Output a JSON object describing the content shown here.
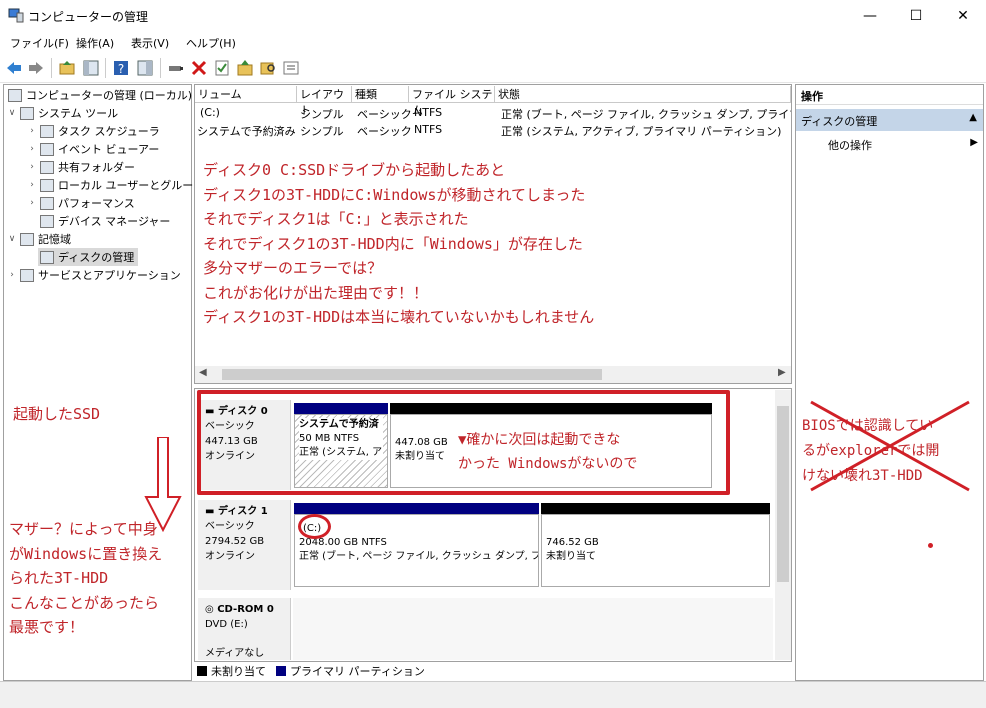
{
  "window": {
    "title": "コンピューターの管理",
    "minimize": "—",
    "maximize": "☐",
    "close": "✕"
  },
  "menu": [
    "ファイル(F)",
    "操作(A)",
    "表示(V)",
    "ヘルプ(H)"
  ],
  "tree": [
    {
      "label": "コンピューターの管理 (ローカル)",
      "icon": "computer-management-icon"
    },
    {
      "label": "システム ツール",
      "icon": "tools-icon"
    },
    {
      "label": "タスク スケジューラ",
      "icon": "clock-icon"
    },
    {
      "label": "イベント ビューアー",
      "icon": "event-viewer-icon"
    },
    {
      "label": "共有フォルダー",
      "icon": "shared-folder-icon"
    },
    {
      "label": "ローカル ユーザーとグループ",
      "icon": "users-icon"
    },
    {
      "label": "パフォーマンス",
      "icon": "performance-icon"
    },
    {
      "label": "デバイス マネージャー",
      "icon": "device-manager-icon"
    },
    {
      "label": "記憶域",
      "icon": "storage-icon"
    },
    {
      "label": "ディスクの管理",
      "icon": "disk-management-icon"
    },
    {
      "label": "サービスとアプリケーション",
      "icon": "services-icon"
    }
  ],
  "volume_table": {
    "columns": [
      "リューム",
      "レイアウト",
      "種類",
      "ファイル システム",
      "状態"
    ],
    "rows": [
      [
        "(C:)",
        "シンプル",
        "ベーシック",
        "NTFS",
        "正常 (ブート, ページ ファイル, クラッシュ ダンプ, プライマリ パーティ"
      ],
      [
        "システムで予約済み",
        "シンプル",
        "ベーシック",
        "NTFS",
        "正常 (システム, アクティブ, プライマリ パーティション)"
      ]
    ]
  },
  "annotations": {
    "main_lines": [
      "ディスク0 C:SSDドライブから起動したあと",
      "ディスク1の3T-HDDにC:Windowsが移動されてしまった",
      "それでディスク1は「C:」と表示された",
      "それでディスク1の3T-HDD内に「Windows」が存在した",
      "多分マザーのエラーでは？",
      "これがお化けが出た理由です！！",
      "ディスク1の3T-HDDは本当に壊れていないかもしれません"
    ],
    "ssd_label": "起動したSSD",
    "unalloc_note": [
      "▼確かに次回は起動できな",
      "かった Windowsがないので"
    ],
    "left_note": [
      "マザー？によって中身",
      "がWindowsに置き換え",
      "られた3T-HDD",
      "こんなことがあったら",
      "最悪です！"
    ],
    "right_note": [
      "BIOSでは認識してい",
      "るがexplorerでは開",
      "けない壊れ3T-HDD"
    ],
    "accent": "#c0252a"
  },
  "disks": [
    {
      "name": "ディスク 0",
      "type": "ベーシック",
      "size": "447.13 GB",
      "status": "オンライン",
      "partitions": [
        {
          "title": "システムで予約済",
          "size": "50 MB NTFS",
          "status": "正常 (システム, ア"
        },
        {
          "title": "",
          "size": "447.08 GB",
          "status": "未割り当て"
        }
      ]
    },
    {
      "name": "ディスク 1",
      "type": "ベーシック",
      "size": "2794.52 GB",
      "status": "オンライン",
      "partitions": [
        {
          "title": "(C:)",
          "size": "2048.00 GB NTFS",
          "status": "正常 (ブート, ページ ファイル, クラッシュ ダンプ, プラ"
        },
        {
          "title": "",
          "size": "746.52 GB",
          "status": "未割り当て"
        }
      ]
    },
    {
      "name": "CD-ROM 0",
      "type": "DVD (E:)",
      "size": "",
      "status": "メディアなし"
    }
  ],
  "legend": [
    {
      "label": "未割り当て",
      "color": "#000000"
    },
    {
      "label": "プライマリ パーティション",
      "color": "#000080"
    }
  ],
  "actions": {
    "header": "操作",
    "section": "ディスクの管理",
    "item": "他の操作"
  }
}
